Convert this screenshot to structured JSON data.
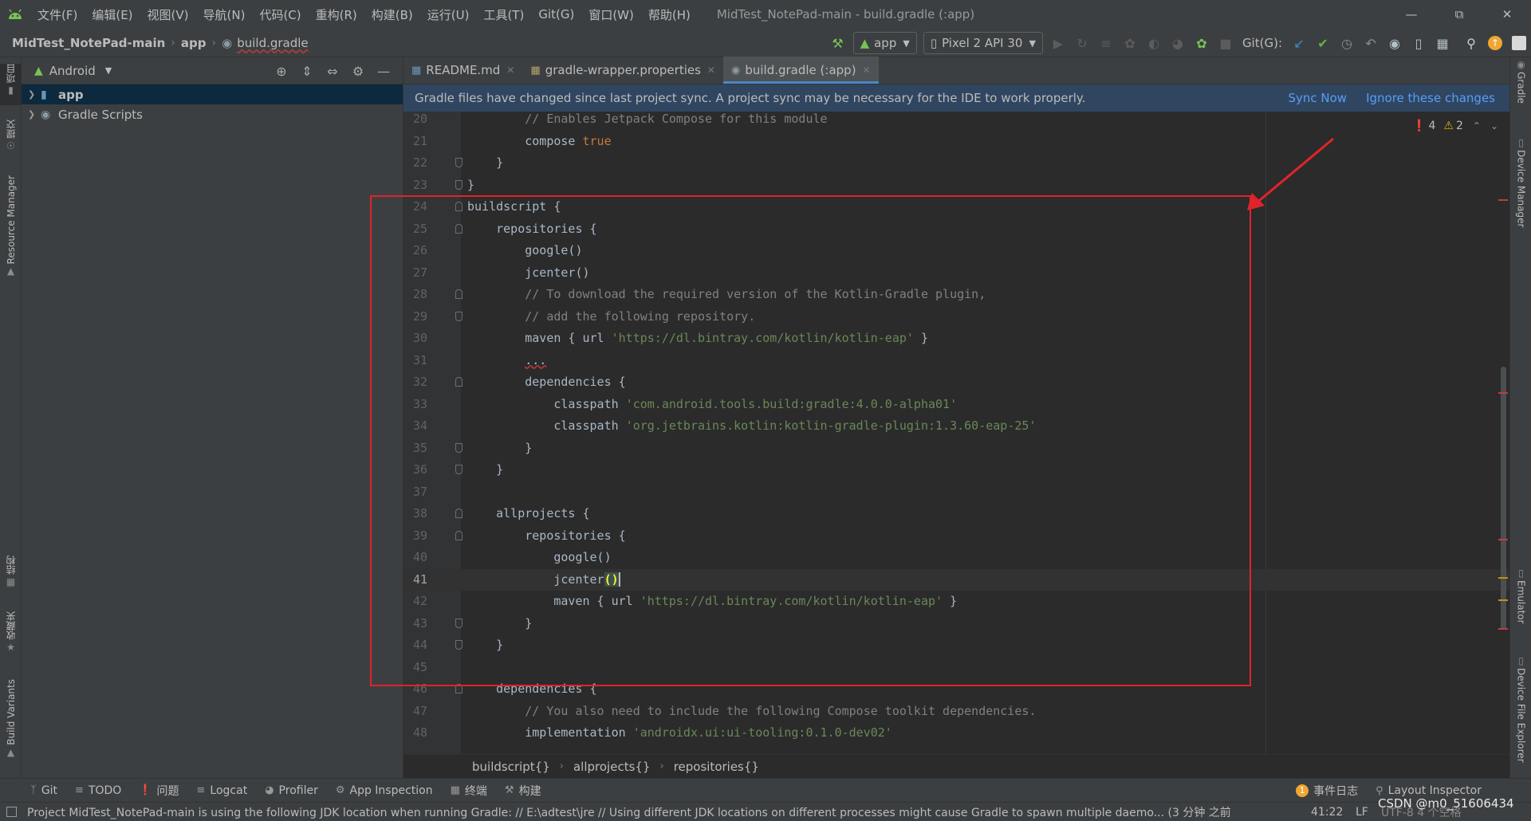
{
  "menubar": {
    "items": [
      "文件(F)",
      "编辑(E)",
      "视图(V)",
      "导航(N)",
      "代码(C)",
      "重构(R)",
      "构建(B)",
      "运行(U)",
      "工具(T)",
      "Git(G)",
      "窗口(W)",
      "帮助(H)"
    ],
    "window_title": "MidTest_NotePad-main - build.gradle (:app)"
  },
  "navbar": {
    "project": "MidTest_NotePad-main",
    "module": "app",
    "file": "build.gradle",
    "run_config": "app",
    "device": "Pixel 2 API 30",
    "git_label": "Git(G):"
  },
  "left_stripe": {
    "project": "项目",
    "commit": "提交",
    "resource_manager": "Resource Manager",
    "structure": "结构",
    "favorites": "收藏夹",
    "build_variants": "Build Variants"
  },
  "right_stripe": {
    "gradle": "Gradle",
    "device_manager": "Device Manager",
    "emulator": "Emulator",
    "device_file_explorer": "Device File Explorer"
  },
  "project_panel": {
    "view": "Android",
    "tree": [
      {
        "label": "app",
        "bold": true,
        "selected": true
      },
      {
        "label": "Gradle Scripts",
        "bold": false,
        "selected": false
      }
    ]
  },
  "tabs": [
    {
      "label": "README.md",
      "active": false
    },
    {
      "label": "gradle-wrapper.properties",
      "active": false
    },
    {
      "label": "build.gradle (:app)",
      "active": true
    }
  ],
  "notification": {
    "message": "Gradle files have changed since last project sync. A project sync may be necessary for the IDE to work properly.",
    "sync_now": "Sync Now",
    "ignore": "Ignore these changes"
  },
  "inspections": {
    "errors": "4",
    "warnings": "2"
  },
  "code": {
    "current_line": 41,
    "lines": [
      {
        "n": "20",
        "fold": "",
        "parts": [
          [
            "        ",
            ""
          ],
          [
            "// Enables Jetpack Compose for this module",
            "c"
          ]
        ]
      },
      {
        "n": "21",
        "fold": "",
        "parts": [
          [
            "        compose ",
            ""
          ],
          [
            "true",
            "k"
          ]
        ]
      },
      {
        "n": "22",
        "fold": "end",
        "parts": [
          [
            "    }",
            ""
          ]
        ]
      },
      {
        "n": "23",
        "fold": "end",
        "parts": [
          [
            "}",
            ""
          ]
        ]
      },
      {
        "n": "24",
        "fold": "start",
        "parts": [
          [
            "buildscript {",
            ""
          ]
        ]
      },
      {
        "n": "25",
        "fold": "start",
        "parts": [
          [
            "    repositories {",
            ""
          ]
        ]
      },
      {
        "n": "26",
        "fold": "",
        "parts": [
          [
            "        google()",
            ""
          ]
        ]
      },
      {
        "n": "27",
        "fold": "",
        "parts": [
          [
            "        jcenter()",
            ""
          ]
        ]
      },
      {
        "n": "28",
        "fold": "start",
        "parts": [
          [
            "        ",
            ""
          ],
          [
            "// To download the required version of the Kotlin-Gradle plugin,",
            "c"
          ]
        ]
      },
      {
        "n": "29",
        "fold": "end",
        "parts": [
          [
            "        ",
            ""
          ],
          [
            "// add the following repository.",
            "c"
          ]
        ]
      },
      {
        "n": "30",
        "fold": "",
        "parts": [
          [
            "        maven { url ",
            ""
          ],
          [
            "'https://dl.bintray.com/kotlin/kotlin-eap'",
            "s"
          ],
          [
            " }",
            ""
          ]
        ]
      },
      {
        "n": "31",
        "fold": "",
        "parts": [
          [
            "        ",
            ""
          ],
          [
            "...",
            "err"
          ]
        ]
      },
      {
        "n": "32",
        "fold": "start",
        "parts": [
          [
            "        dependencies {",
            ""
          ]
        ]
      },
      {
        "n": "33",
        "fold": "",
        "parts": [
          [
            "            classpath ",
            ""
          ],
          [
            "'com.android.tools.build:gradle:4.0.0-alpha01'",
            "s"
          ]
        ]
      },
      {
        "n": "34",
        "fold": "",
        "parts": [
          [
            "            classpath ",
            ""
          ],
          [
            "'org.jetbrains.kotlin:kotlin-gradle-plugin:1.3.60-eap-25'",
            "s"
          ]
        ]
      },
      {
        "n": "35",
        "fold": "end",
        "parts": [
          [
            "        }",
            ""
          ]
        ]
      },
      {
        "n": "36",
        "fold": "end",
        "parts": [
          [
            "    }",
            ""
          ]
        ]
      },
      {
        "n": "37",
        "fold": "",
        "parts": [
          [
            "",
            ""
          ]
        ]
      },
      {
        "n": "38",
        "fold": "start",
        "parts": [
          [
            "    allprojects {",
            ""
          ]
        ]
      },
      {
        "n": "39",
        "fold": "start",
        "parts": [
          [
            "        repositories {",
            ""
          ]
        ]
      },
      {
        "n": "40",
        "fold": "",
        "parts": [
          [
            "            google()",
            ""
          ]
        ]
      },
      {
        "n": "41",
        "fold": "",
        "parts": [
          [
            "            jcenter",
            ""
          ],
          [
            "()",
            "br"
          ],
          [
            "",
            "caret"
          ]
        ]
      },
      {
        "n": "42",
        "fold": "",
        "parts": [
          [
            "            maven { url ",
            ""
          ],
          [
            "'https://dl.bintray.com/kotlin/kotlin-eap'",
            "s"
          ],
          [
            " }",
            ""
          ]
        ]
      },
      {
        "n": "43",
        "fold": "end",
        "parts": [
          [
            "        }",
            ""
          ]
        ]
      },
      {
        "n": "44",
        "fold": "end",
        "parts": [
          [
            "    }",
            ""
          ]
        ]
      },
      {
        "n": "45",
        "fold": "",
        "parts": [
          [
            "",
            ""
          ]
        ]
      },
      {
        "n": "46",
        "fold": "start",
        "parts": [
          [
            "    dependencies {",
            ""
          ]
        ]
      },
      {
        "n": "47",
        "fold": "",
        "parts": [
          [
            "        ",
            ""
          ],
          [
            "// You also need to include the following Compose toolkit dependencies.",
            "c"
          ]
        ]
      },
      {
        "n": "48",
        "fold": "",
        "parts": [
          [
            "        implementation ",
            ""
          ],
          [
            "'androidx.ui:ui-tooling:0.1.0-dev02'",
            "s"
          ]
        ]
      }
    ]
  },
  "breadcrumbs": [
    "buildscript{}",
    "allprojects{}",
    "repositories{}"
  ],
  "bottom_tools": {
    "items": [
      {
        "icon": "git-icon",
        "label": "Git"
      },
      {
        "icon": "todo-icon",
        "label": "TODO"
      },
      {
        "icon": "problems-icon",
        "label": "问题"
      },
      {
        "icon": "logcat-icon",
        "label": "Logcat"
      },
      {
        "icon": "profiler-icon",
        "label": "Profiler"
      },
      {
        "icon": "app-inspection-icon",
        "label": "App Inspection"
      },
      {
        "icon": "terminal-icon",
        "label": "终端"
      },
      {
        "icon": "build-icon",
        "label": "构建"
      }
    ],
    "event_log": "事件日志",
    "event_count": "1",
    "layout_inspector": "Layout Inspector"
  },
  "statusbar": {
    "message": "Project MidTest_NotePad-main is using the following JDK location when running Gradle: // E:\\adtest\\jre // Using different JDK locations on different processes might cause Gradle to spawn multiple daemo... (3 分钟 之前",
    "position": "41:22",
    "line_sep": "LF",
    "encoding": "UTF-8  4 个空格",
    "watermark": "CSDN @m0_51606434"
  },
  "colors": {
    "annotation": "#e0232b",
    "accent": "#4a88c7",
    "link": "#589df6"
  }
}
